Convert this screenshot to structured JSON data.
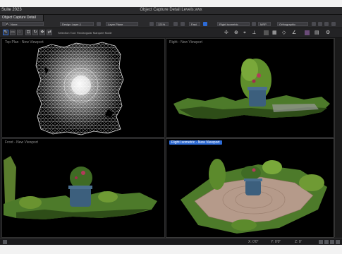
{
  "window": {
    "app_name": "Suite 2023",
    "document_title": "Object Capture Detail Levels.vwx",
    "document_tab": "Object Capture Detail Lev..."
  },
  "toolbar": {
    "class_select": "None",
    "layer_select": "Design Layer-1",
    "view_select": "Layer Plane",
    "zoom": "121%",
    "render_mode": "Fast",
    "view_mode": "Right Isometric",
    "render_select": "MRP",
    "projection": "Orthographic"
  },
  "tool_mode_status": "Selection Tool: Rectangular Marquee Mode",
  "panes": [
    {
      "label": "Top Plan - New Viewport"
    },
    {
      "label": "Right - New Viewport"
    },
    {
      "label": "Front - New Viewport"
    },
    {
      "label": "Right Isometric - New Viewport"
    }
  ],
  "status": {
    "x": "X: 0'0\"",
    "y": "Y: 0'0\"",
    "z": "Z: 0'"
  },
  "colors": {
    "accent": "#2d6bd6",
    "window_bg": "#1c1c1e",
    "foliage": "#4c7a2a"
  }
}
